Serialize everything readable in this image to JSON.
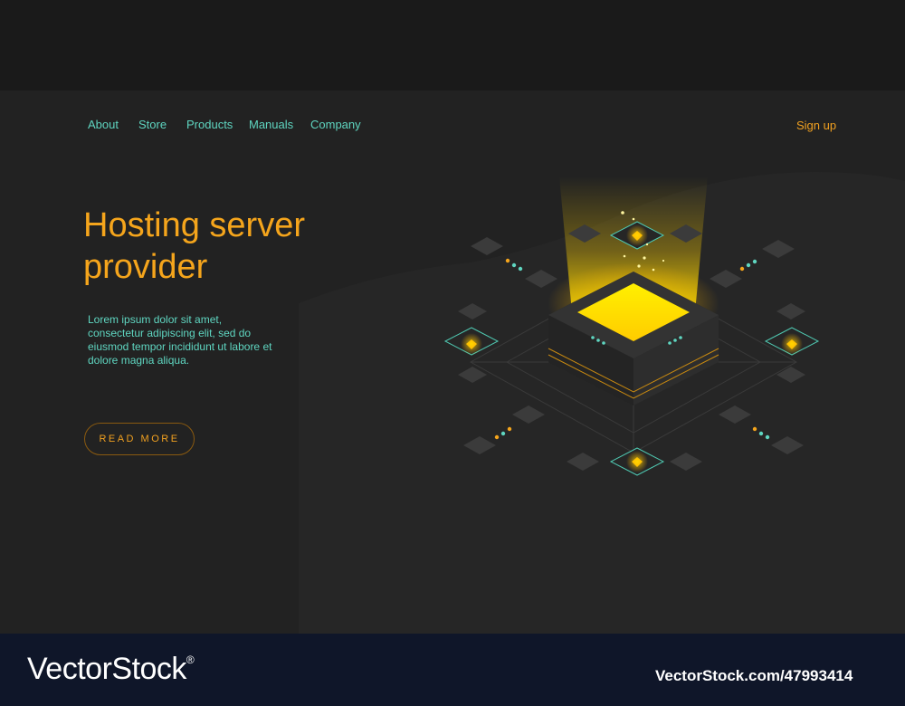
{
  "nav": {
    "items": [
      {
        "label": "About"
      },
      {
        "label": "Store"
      },
      {
        "label": "Products"
      },
      {
        "label": "Manuals"
      },
      {
        "label": "Company"
      }
    ],
    "signup_label": "Sign up"
  },
  "hero": {
    "title_line1": "Hosting server",
    "title_line2": "provider",
    "description": "Lorem ipsum dolor sit amet, consectetur adipiscing elit, sed do eiusmod tempor incididunt ut labore et dolore magna aliqua.",
    "button_label": "READ MORE",
    "illustration_icon": "isometric-server-illustration"
  },
  "footer": {
    "logo_text": "VectorStock",
    "logo_mark": "®",
    "image_id": "VectorStock.com/47993414"
  },
  "colors": {
    "accent_orange": "#f5a51c",
    "accent_teal": "#5fd6c1",
    "glow_yellow": "#ffe000",
    "background": "#222222",
    "footer_bg": "#0f1629"
  }
}
